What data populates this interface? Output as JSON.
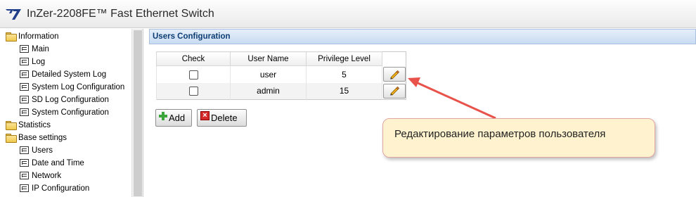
{
  "header": {
    "title": "InZer-2208FE™ Fast Ethernet Switch",
    "logo_icon": "switch-logo-icon"
  },
  "sidebar": {
    "items": [
      {
        "label": "Information",
        "type": "folder"
      },
      {
        "label": "Main",
        "type": "page"
      },
      {
        "label": "Log",
        "type": "page"
      },
      {
        "label": "Detailed System Log",
        "type": "page"
      },
      {
        "label": "System Log Configuration",
        "type": "page"
      },
      {
        "label": "SD Log Configuration",
        "type": "page"
      },
      {
        "label": "System Configuration",
        "type": "page"
      },
      {
        "label": "Statistics",
        "type": "folder"
      },
      {
        "label": "Base settings",
        "type": "folder"
      },
      {
        "label": "Users",
        "type": "page"
      },
      {
        "label": "Date and Time",
        "type": "page"
      },
      {
        "label": "Network",
        "type": "page"
      },
      {
        "label": "IP Configuration",
        "type": "page"
      }
    ]
  },
  "main": {
    "section_title": "Users Configuration",
    "table": {
      "columns": [
        "Check",
        "User Name",
        "Privilege Level"
      ],
      "rows": [
        {
          "checked": false,
          "user_name": "user",
          "privilege_level": "5"
        },
        {
          "checked": false,
          "user_name": "admin",
          "privilege_level": "15"
        }
      ]
    },
    "buttons": {
      "add_label": "Add",
      "delete_label": "Delete"
    }
  },
  "annotation": {
    "text": "Редактирование параметров пользователя",
    "arrow_color": "#e8524a",
    "box_color": "#fff3cf"
  },
  "colors": {
    "section_title": "#0e3d73",
    "section_bar": "#c9dcf2"
  }
}
